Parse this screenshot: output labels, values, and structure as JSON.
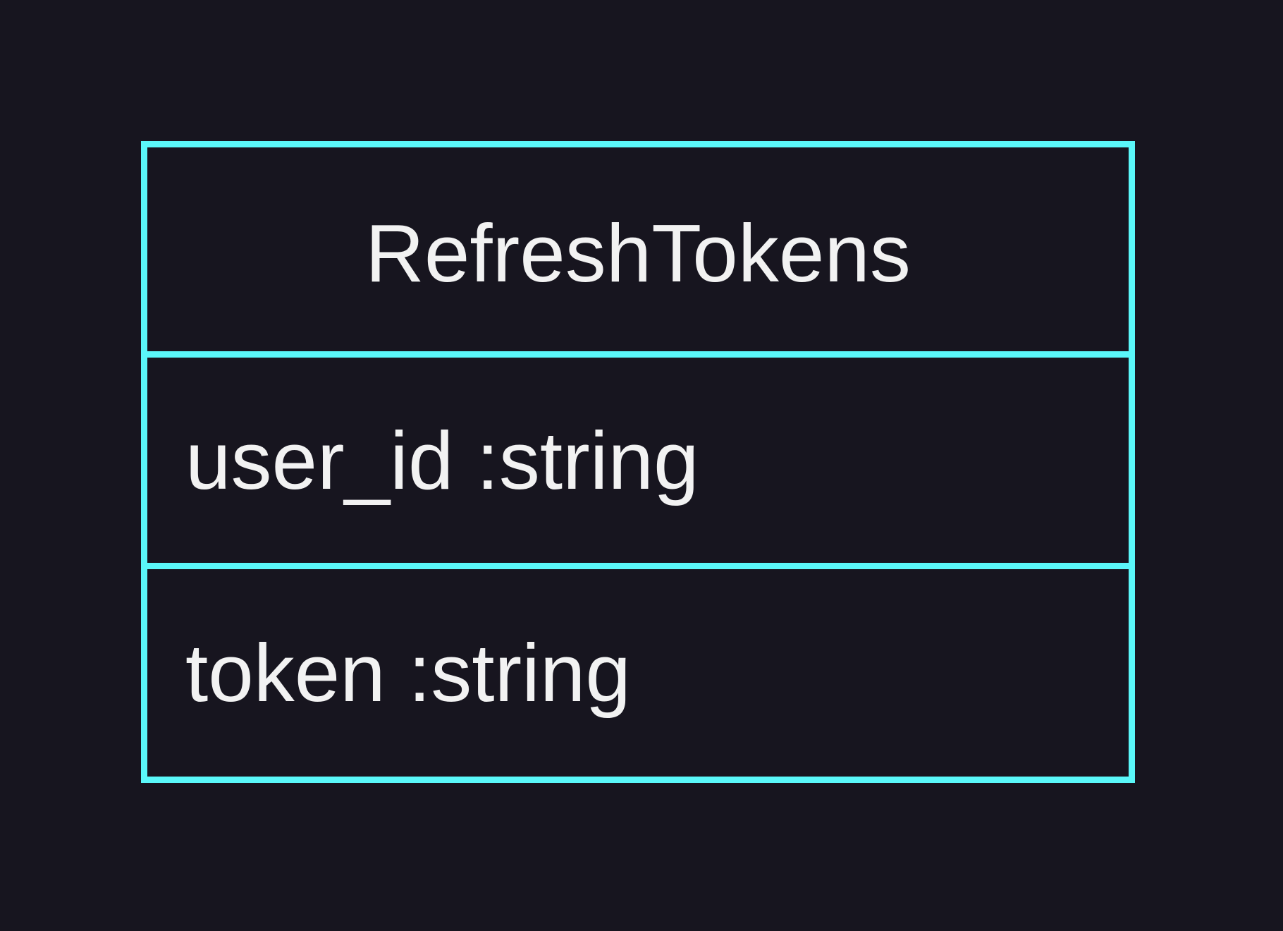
{
  "diagram": {
    "entity": {
      "name": "RefreshTokens",
      "attributes": [
        {
          "text": "user_id :string"
        },
        {
          "text": "token :string"
        }
      ]
    }
  },
  "colors": {
    "background": "#17151f",
    "border": "#5af7f9",
    "text": "#f2f2f2"
  }
}
